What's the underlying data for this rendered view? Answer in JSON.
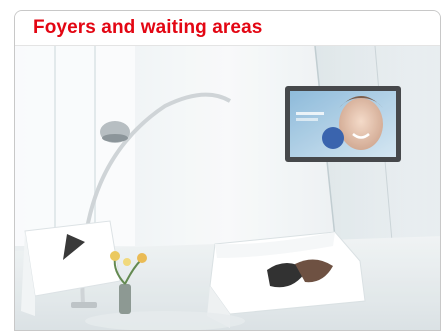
{
  "section": {
    "title": "Foyers and waiting areas"
  },
  "colors": {
    "title": "#e30613",
    "screen_logo": "#1f4fa3"
  },
  "photo": {
    "subject": "bright white lounge with arc floor lamp, white leather sofa with black and brown cushions, flowers, and a wall-mounted digital signage screen showing a smiling woman"
  }
}
